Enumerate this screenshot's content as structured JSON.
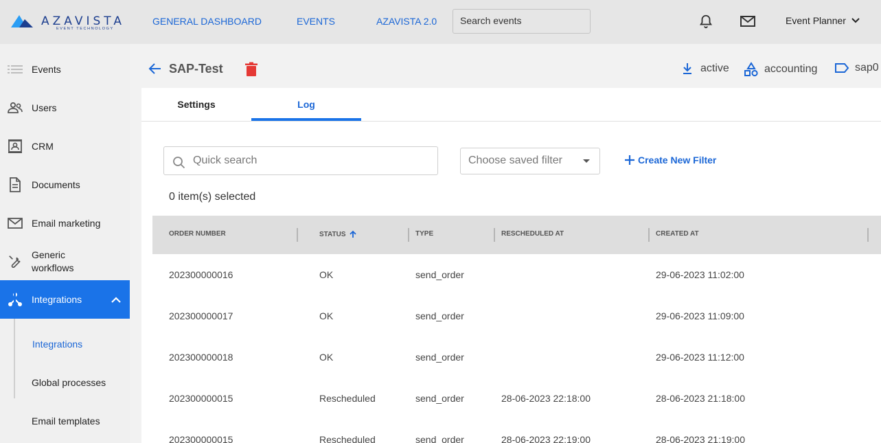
{
  "brand": {
    "name": "AZAVISTA",
    "tagline": "EVENT TECHNOLOGY"
  },
  "topnav": {
    "links": [
      "GENERAL DASHBOARD",
      "EVENTS",
      "AZAVISTA 2.0"
    ],
    "search_placeholder": "Search events",
    "user": "Event Planner"
  },
  "sidebar": {
    "items": [
      {
        "label": "Events",
        "icon": "list-icon"
      },
      {
        "label": "Users",
        "icon": "users-icon"
      },
      {
        "label": "CRM",
        "icon": "contact-card-icon"
      },
      {
        "label": "Documents",
        "icon": "document-icon"
      },
      {
        "label": "Email marketing",
        "icon": "mail-icon"
      },
      {
        "label": "Generic workflows",
        "icon": "wrench-icon"
      },
      {
        "label": "Integrations",
        "icon": "network-icon",
        "active": true
      }
    ],
    "subitems": [
      "Integrations",
      "Global processes",
      "Email templates"
    ]
  },
  "header": {
    "title": "SAP-Test",
    "status": "active",
    "category": "accounting",
    "tag": "sap0"
  },
  "tabs": [
    "Settings",
    "Log"
  ],
  "toolbar": {
    "quick_search_placeholder": "Quick search",
    "saved_filter": "Choose saved filter",
    "create_filter": "Create New Filter",
    "selected_count": "0 item(s) selected"
  },
  "table": {
    "columns": [
      "ORDER NUMBER",
      "STATUS",
      "TYPE",
      "RESCHEDULED AT",
      "CREATED AT"
    ],
    "rows": [
      {
        "order": "202300000016",
        "status": "OK",
        "type": "send_order",
        "rescheduled": "",
        "created": "29-06-2023 11:02:00"
      },
      {
        "order": "202300000017",
        "status": "OK",
        "type": "send_order",
        "rescheduled": "",
        "created": "29-06-2023 11:09:00"
      },
      {
        "order": "202300000018",
        "status": "OK",
        "type": "send_order",
        "rescheduled": "",
        "created": "29-06-2023 11:12:00"
      },
      {
        "order": "202300000015",
        "status": "Rescheduled",
        "type": "send_order",
        "rescheduled": "28-06-2023 22:18:00",
        "created": "28-06-2023 21:18:00"
      },
      {
        "order": "202300000015",
        "status": "Rescheduled",
        "type": "send_order",
        "rescheduled": "28-06-2023 22:19:00",
        "created": "28-06-2023 21:19:00"
      }
    ]
  },
  "colors": {
    "accent": "#1a73e8",
    "link": "#1a66d6",
    "danger": "#e53935"
  }
}
